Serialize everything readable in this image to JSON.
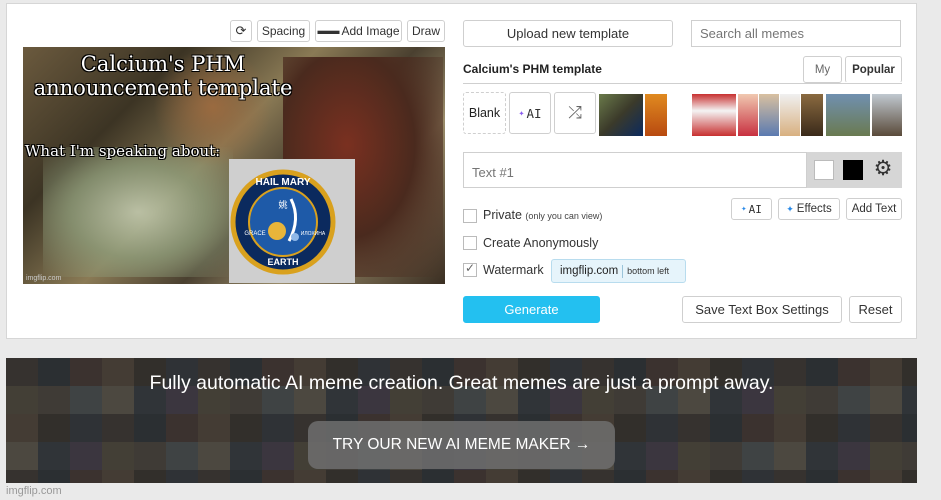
{
  "toolbar": {
    "rotate_icon": "rotate-icon",
    "spacing_label": "Spacing",
    "add_image_label": "Add Image",
    "draw_label": "Draw"
  },
  "meme": {
    "line1": "Calcium's PHM",
    "line2": "announcement template",
    "line3": "What I'm speaking about:",
    "watermark": "imgflip.com",
    "patch": {
      "top": "HAIL MARY",
      "symbol": "姚",
      "left": "GRACE",
      "right": "ИЛОХИНА",
      "bottom": "EARTH"
    }
  },
  "sidebar": {
    "upload_label": "Upload new template",
    "search_placeholder": "Search all memes",
    "template_title": "Calcium's PHM template",
    "tab_my": "My",
    "tab_popular": "Popular",
    "blank_label": "Blank",
    "ai_label": "AI",
    "shuffle_icon": "shuffle-icon",
    "text_placeholder": "Text #1",
    "color_white": "#ffffff",
    "color_black": "#000000",
    "settings_icon": "gear-icon",
    "ai_small_label": "AI",
    "effects_label": "Effects",
    "add_text_label": "Add Text",
    "private_label": "Private",
    "private_note": "(only you can view)",
    "anon_label": "Create Anonymously",
    "watermark_label": "Watermark",
    "watermark_value": "imgflip.com",
    "watermark_position": "bottom left",
    "generate_label": "Generate",
    "save_settings_label": "Save Text Box Settings",
    "reset_label": "Reset",
    "accent": "#23c0f0"
  },
  "banner": {
    "headline": "Fully automatic AI meme creation. Great memes are just a prompt away.",
    "cta": "TRY OUR NEW AI MEME MAKER →"
  },
  "footer": {
    "watermark": "imgflip.com"
  }
}
